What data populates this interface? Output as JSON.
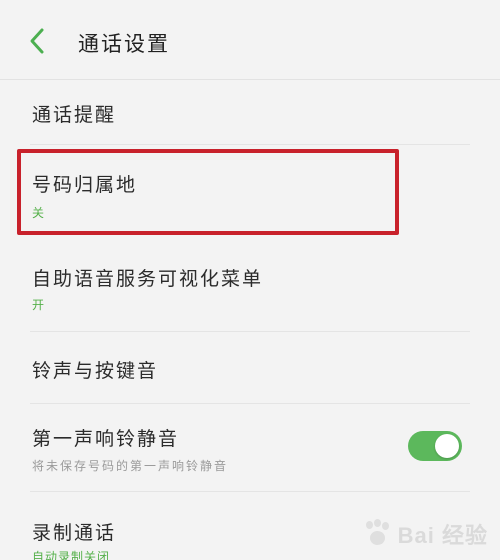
{
  "header": {
    "title": "通话设置",
    "back_icon": "chevron-left-icon",
    "accent": "#4caf50"
  },
  "settings": [
    {
      "title": "通话提醒"
    },
    {
      "title": "号码归属地",
      "value": "关"
    },
    {
      "title": "自助语音服务可视化菜单",
      "value": "开"
    },
    {
      "title": "铃声与按键音"
    },
    {
      "title": "第一声响铃静音",
      "description": "将未保存号码的第一声响铃静音",
      "toggle": true
    },
    {
      "title": "录制通话",
      "value": "自动录制关闭"
    }
  ],
  "highlight": {
    "color": "#c8212b",
    "target": "号码归属地"
  },
  "watermark": {
    "text": "Bai 经验"
  },
  "colors": {
    "value_green": "#55b04a",
    "toggle_on": "#5cb85c",
    "background": "#f3f3f3"
  }
}
